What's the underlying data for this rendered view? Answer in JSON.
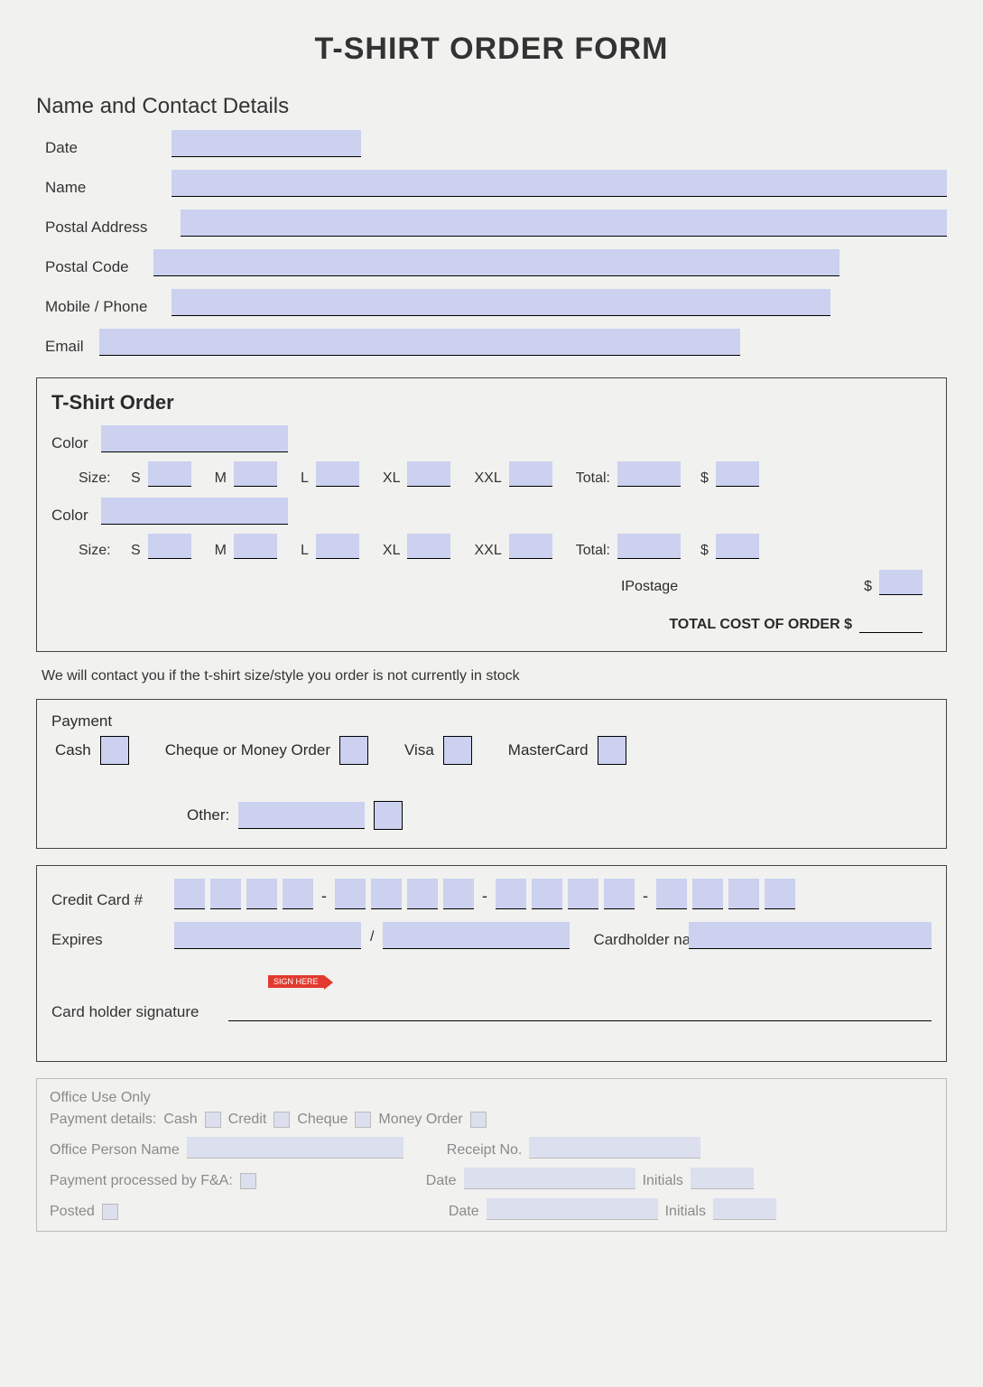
{
  "title": "T-SHIRT ORDER FORM",
  "contact": {
    "heading": "Name and Contact Details",
    "date": "Date",
    "name": "Name",
    "postal_address": "Postal   Address",
    "postal_code": "Postal Code",
    "mobile": "Mobile / Phone",
    "email": "Email"
  },
  "order": {
    "heading": "T-Shirt Order",
    "color": "Color",
    "size": "Size:",
    "s": "S",
    "m": "M",
    "l": "L",
    "xl": "XL",
    "xxl": "XXL",
    "total": "Total:",
    "dollar": "$",
    "postage": "IPostage",
    "total_cost": "TOTAL COST OF ORDER  $"
  },
  "note": "We will contact you if the t-shirt size/style you order is not currently in stock",
  "payment": {
    "heading": "Payment",
    "cash": "Cash",
    "cheque": "Cheque or Money Order",
    "visa": "Visa",
    "mastercard": "MasterCard",
    "other": "Other:"
  },
  "card": {
    "cc_no": "Credit Card #",
    "expires": "Expires",
    "slash": "/",
    "holder_name": "Cardholder name",
    "signature": "Card holder signature",
    "sign_tag": "SIGN HERE"
  },
  "office": {
    "heading": "Office  Use Only",
    "pay_details": "Payment details:",
    "cash": "Cash",
    "credit": "Credit",
    "cheque": "Cheque",
    "money_order": "Money Order",
    "person": "Office Person Name",
    "receipt": "Receipt No.",
    "processed": "Payment processed by F&A:",
    "posted": "Posted",
    "date": "Date",
    "initials": "Initials"
  }
}
